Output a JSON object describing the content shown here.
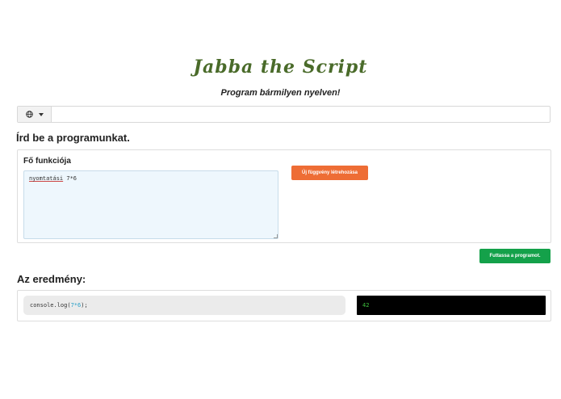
{
  "header": {
    "title": "Jabba the Script",
    "subtitle": "Program bármilyen nyelven!"
  },
  "language_bar": {
    "icon": "globe-icon",
    "dropdown_icon": "caret-down-icon",
    "value": ""
  },
  "editor": {
    "heading": "Írd be a programunkat.",
    "function_label": "Fő funkciója",
    "code_keyword": "nyomtatási",
    "code_rest": " 7*6",
    "new_function_label": "Új függvény létrehozása"
  },
  "run_button": {
    "label": "Futtassa a programot."
  },
  "result": {
    "heading": "Az eredmény:",
    "code_prefix": "console.log(",
    "code_num1": "7",
    "code_op": " * ",
    "code_num2": "6",
    "code_suffix": ");",
    "console_output": "42"
  },
  "colors": {
    "title": "#4a6b2a",
    "new_function_button": "#ee6d35",
    "run_button": "#14a14a",
    "console_bg": "#000000",
    "console_text": "#3ec23e"
  }
}
